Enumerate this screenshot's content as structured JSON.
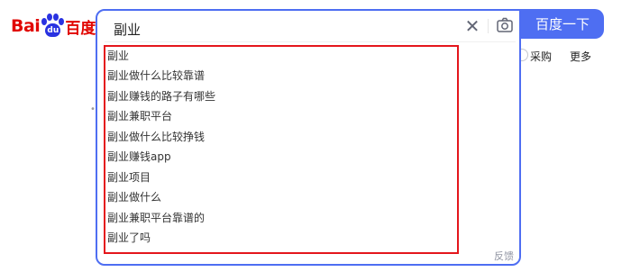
{
  "logo": {
    "brand_latin": "Bai",
    "paw_text": "du",
    "brand_cn": "百度"
  },
  "search": {
    "query": "副业",
    "button_label": "百度一下",
    "clear_icon": "close-icon",
    "camera_icon": "camera-icon"
  },
  "suggestions": [
    {
      "label": "副业"
    },
    {
      "label": "副业做什么比较靠谱"
    },
    {
      "label": "副业赚钱的路子有哪些"
    },
    {
      "label": "副业兼职平台"
    },
    {
      "label": "副业做什么比较挣钱"
    },
    {
      "label": "副业赚钱app"
    },
    {
      "label": "副业项目"
    },
    {
      "label": "副业做什么"
    },
    {
      "label": "副业兼职平台靠谱的"
    },
    {
      "label": "副业了吗"
    }
  ],
  "feedback_label": "反馈",
  "nav": {
    "purchase": "采购",
    "more": "更多"
  },
  "colors": {
    "brand_red": "#e10601",
    "brand_blue": "#2932e1",
    "accent": "#4e6ef2",
    "highlight_border": "#e4161c"
  }
}
